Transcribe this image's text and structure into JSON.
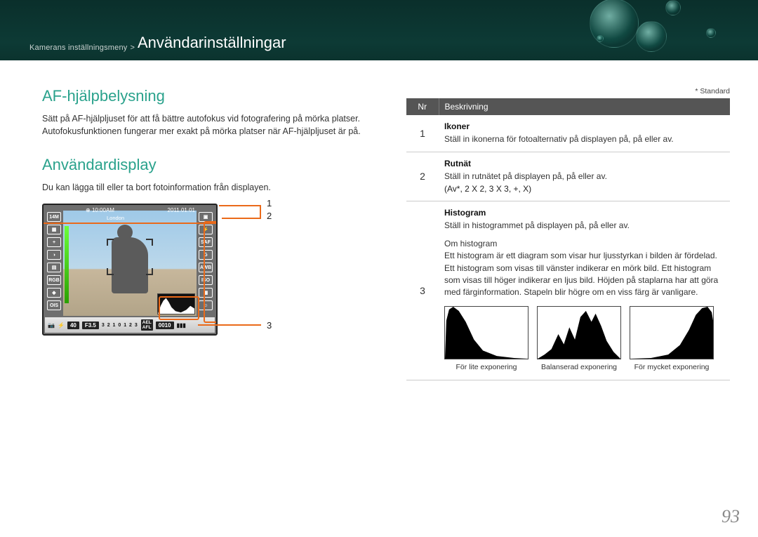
{
  "breadcrumb": {
    "small": "Kamerans inställningsmeny",
    "sep": ">",
    "large": "Användarinställningar"
  },
  "left": {
    "title1": "AF-hjälpbelysning",
    "para1": "Sätt på AF-hjälpljuset för att få bättre autofokus vid fotografering på mörka platser. Autofokusfunktionen fungerar mer exakt på mörka platser när AF-hjälpljuset är på.",
    "title2": "Användardisplay",
    "para2": "Du kan lägga till eller ta bort fotoinformation från displayen.",
    "callouts": {
      "n1": "1",
      "n2": "2",
      "n3": "3"
    },
    "screen": {
      "res": "14M",
      "time": "10:00AM",
      "date": "2011.01.01",
      "city": "London",
      "bottom": {
        "shutter": "40",
        "fnum": "F3.5",
        "frames": "0010",
        "ael": "AEL",
        "afl": "AFL"
      }
    }
  },
  "right": {
    "star_note": "* Standard",
    "th_nr": "Nr",
    "th_desc": "Beskrivning",
    "rows": [
      {
        "nr": "1",
        "label": "Ikoner",
        "desc": "Ställ in ikonerna för fotoalternativ på displayen på, på eller av."
      },
      {
        "nr": "2",
        "label": "Rutnät",
        "desc": "Ställ in rutnätet på displayen på, på eller av.",
        "opts": "(Av*, 2 X 2, 3 X 3, +, X)"
      },
      {
        "nr": "3",
        "label": "Histogram",
        "desc": "Ställ in histogrammet på displayen på, på eller av.",
        "sub_title": "Om histogram",
        "sub_desc": "Ett histogram är ett diagram som visar hur ljusstyrkan i bilden är fördelad. Ett histogram som visas till vänster indikerar en mörk bild. Ett histogram som visas till höger indikerar en ljus bild. Höjden på staplarna har att göra med färginformation. Stapeln blir högre om en viss färg är vanligare.",
        "captions": [
          "För lite exponering",
          "Balanserad exponering",
          "För mycket exponering"
        ]
      }
    ]
  },
  "page_number": "93"
}
